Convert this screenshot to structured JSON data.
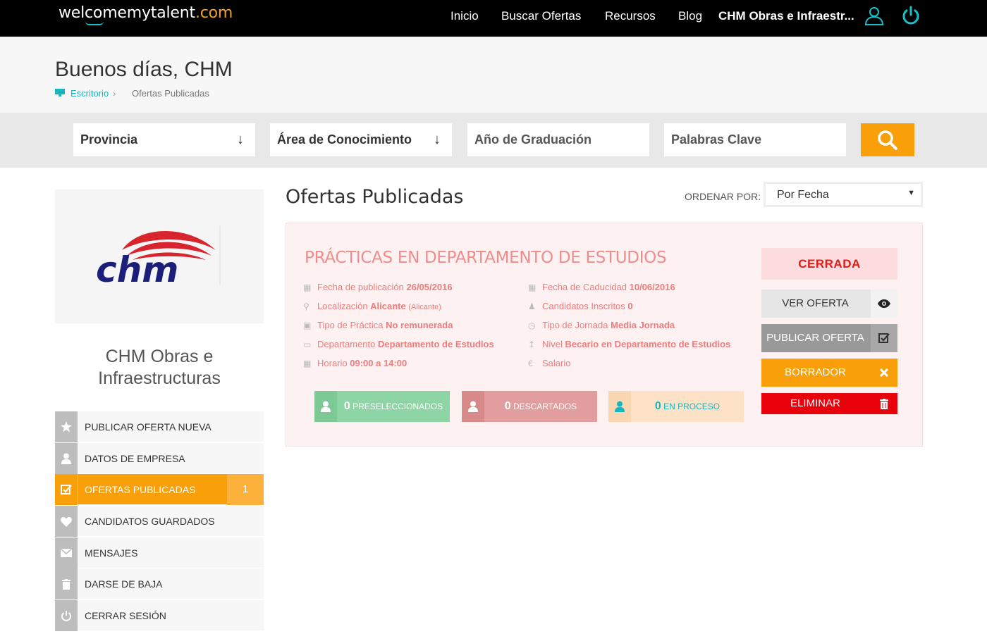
{
  "top_nav": {
    "logo": {
      "part1": "welcomemytalent",
      "part2": ".com"
    },
    "links": [
      "Inicio",
      "Buscar Ofertas",
      "Recursos",
      "Blog"
    ],
    "company_link": "CHM Obras e Infraestr..."
  },
  "header": {
    "greeting": "Buenos días, CHM",
    "breadcrumb": {
      "home": "Escritorio",
      "separator": "›",
      "current": "Ofertas Publicadas"
    }
  },
  "search": {
    "provincia": "Provincia",
    "area": "Área de Conocimiento",
    "anio_placeholder": "Año de Graduación",
    "keywords_placeholder": "Palabras Clave"
  },
  "sidebar": {
    "company_name_line1": "CHM Obras e",
    "company_name_line2": "Infraestructuras",
    "menu": [
      {
        "label": "PUBLICAR OFERTA NUEVA",
        "icon": "star-icon"
      },
      {
        "label": "DATOS DE EMPRESA",
        "icon": "user-icon"
      },
      {
        "label": "OFERTAS PUBLICADAS",
        "icon": "checkbox-icon",
        "count": "1",
        "active": true
      },
      {
        "label": "CANDIDATOS GUARDADOS",
        "icon": "heart-icon"
      },
      {
        "label": "MENSAJES",
        "icon": "envelope-icon"
      },
      {
        "label": "DARSE DE BAJA",
        "icon": "trash-icon"
      },
      {
        "label": "CERRAR SESIÓN",
        "icon": "power-icon"
      }
    ]
  },
  "main": {
    "title": "Ofertas Publicadas",
    "order_label": "ORDENAR POR:",
    "order_value": "Por Fecha"
  },
  "offer": {
    "title": "PRÁCTICAS EN DEPARTAMENTO DE ESTUDIOS",
    "fecha_publicacion_label": "Fecha de publicación",
    "fecha_publicacion": "26/05/2016",
    "localizacion_label": "Localización",
    "localizacion": "Alicante",
    "localizacion_extra": "(Alicante)",
    "tipo_practica_label": "Tipo de Práctica",
    "tipo_practica": "No remunerada",
    "departamento_label": "Departamento",
    "departamento": "Departamento de Estudios",
    "horario_label": "Horario",
    "horario": "09:00 a 14:00",
    "fecha_caducidad_label": "Fecha de Caducidad",
    "fecha_caducidad": "10/06/2016",
    "candidatos_label": "Candidatos Inscritos",
    "candidatos": "0",
    "jornada_label": "Tipo de Jornada",
    "jornada": "Media Jornada",
    "nivel_label": "Nivel",
    "nivel": "Becario en Departamento de Estudios",
    "salario_label": "Salario",
    "stats": {
      "preseleccionados_count": "0",
      "preseleccionados_label": "PRESELECCIONADOS",
      "descartados_count": "0",
      "descartados_label": "DESCARTADOS",
      "en_proceso_count": "0",
      "en_proceso_label": "EN PROCESO"
    },
    "status": "CERRADA",
    "actions": {
      "ver": "VER OFERTA",
      "publicar": "PUBLICAR OFERTA",
      "borrador": "BORRADOR",
      "eliminar": "ELIMINAR"
    }
  },
  "colors": {
    "accent": "#f89f0a",
    "teal": "#19b5bf",
    "danger": "#e21a1a",
    "offer_text": "#ee7c7c"
  }
}
